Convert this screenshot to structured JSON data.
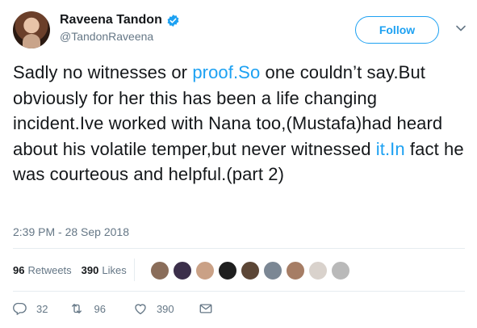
{
  "user": {
    "display_name": "Raveena Tandon",
    "handle": "@TandonRaveena"
  },
  "follow_label": "Follow",
  "tweet": {
    "segments": [
      {
        "text": "Sadly no witnesses or ",
        "link": false
      },
      {
        "text": "proof.So",
        "link": true
      },
      {
        "text": " one couldn’t say.But obviously for her this has been a life changing incident.Ive worked with Nana too,(Mustafa)had heard about his volatile temper,but never witnessed ",
        "link": false
      },
      {
        "text": "it.In",
        "link": true
      },
      {
        "text": " fact he was courteous and helpful.(part 2)",
        "link": false
      }
    ],
    "timestamp": "2:39 PM - 28 Sep 2018"
  },
  "stats": {
    "retweets_count": "96",
    "retweets_label": "Retweets",
    "likes_count": "390",
    "likes_label": "Likes"
  },
  "likers": [
    "#8a6d5a",
    "#3b2f4a",
    "#caa186",
    "#1e1e1e",
    "#5c4636",
    "#7b8794",
    "#a67d65",
    "#d9d2cc",
    "#b9b9b9"
  ],
  "actions": {
    "replies": "32",
    "retweets": "96",
    "likes": "390"
  },
  "colors": {
    "accent": "#1da1f2",
    "text": "#14171a",
    "muted": "#657786"
  },
  "icons": [
    "verified-badge-icon",
    "chevron-down-icon",
    "reply-icon",
    "retweet-icon",
    "like-icon",
    "direct-message-icon"
  ]
}
